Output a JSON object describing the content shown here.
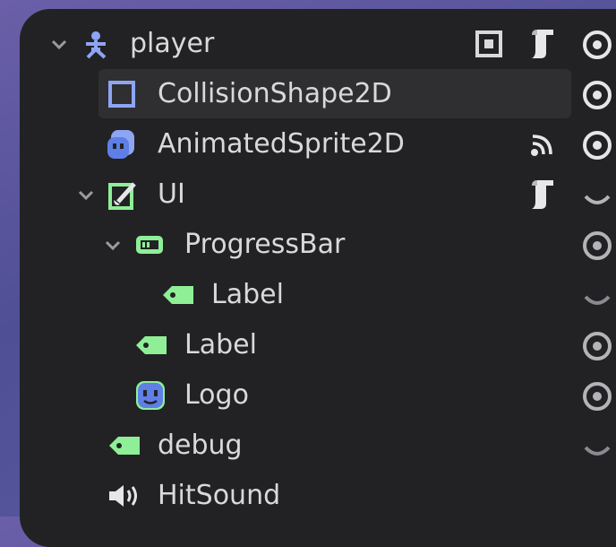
{
  "tree": {
    "nodes": [
      {
        "label": "player",
        "icon": "character-body-2d-icon",
        "expanded": true,
        "indent": 0
      },
      {
        "label": "CollisionShape2D",
        "icon": "collision-shape-2d-icon",
        "selected": true,
        "indent": 1
      },
      {
        "label": "AnimatedSprite2D",
        "icon": "animated-sprite-2d-icon",
        "indent": 1
      },
      {
        "label": "UI",
        "icon": "control-node-icon",
        "expanded": true,
        "indent": 1
      },
      {
        "label": "ProgressBar",
        "icon": "progress-bar-icon",
        "expanded": true,
        "indent": 2
      },
      {
        "label": "Label",
        "icon": "label-icon",
        "indent": 3
      },
      {
        "label": "Label",
        "icon": "label-icon",
        "indent": 2
      },
      {
        "label": "Logo",
        "icon": "texture-rect-icon",
        "indent": 2
      },
      {
        "label": "debug",
        "icon": "label-icon",
        "indent": 1
      },
      {
        "label": "HitSound",
        "icon": "audio-stream-player-icon",
        "indent": 1
      }
    ]
  },
  "colors": {
    "panel_bg": "#222224",
    "selection_bg": "#2f2f32",
    "text": "#d9d9dc",
    "icon_blue": "#8da5f3",
    "icon_green": "#8eef97",
    "icon_gray": "#b3b3b8"
  }
}
